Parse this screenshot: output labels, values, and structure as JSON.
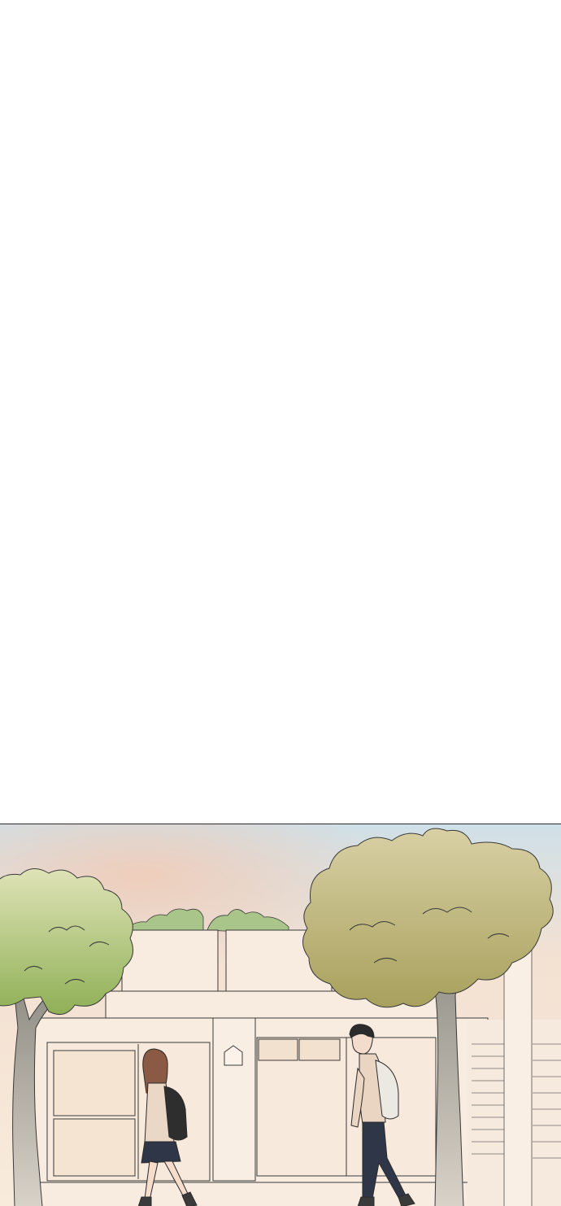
{
  "page": {
    "background": "#ffffff"
  },
  "panel": {
    "scene": "street",
    "colors": {
      "sky_top": "#cfe0e8",
      "sky_warm": "#f6d9c8",
      "building": "#f7eadb",
      "foliage_green": "#9fb86a",
      "foliage_olive": "#b9b173",
      "trunk": "#9a9890",
      "line": "#3a3a3a"
    }
  }
}
